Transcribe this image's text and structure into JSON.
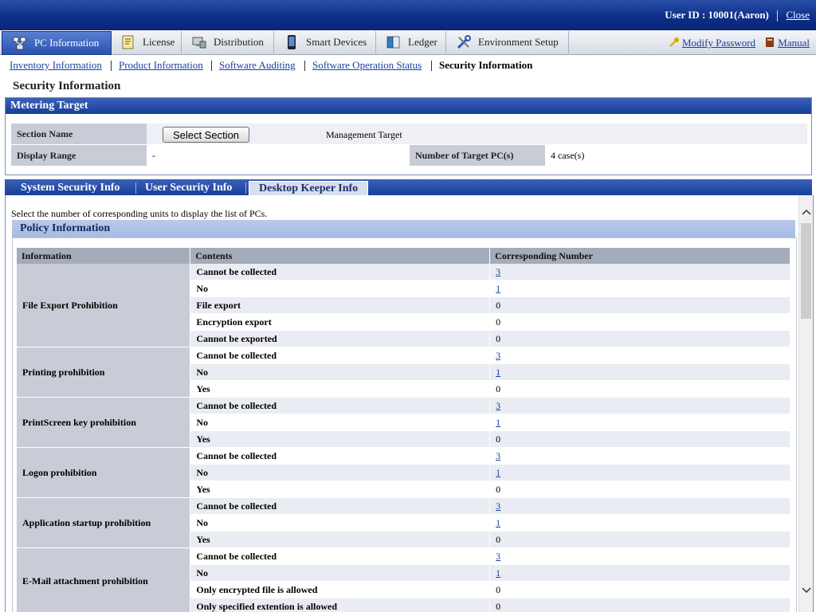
{
  "header": {
    "user_label": "User ID : 10001(Aaron)",
    "close_label": "Close"
  },
  "main_tabs": [
    {
      "label": "PC Information",
      "icon": "pc-network-icon",
      "active": true
    },
    {
      "label": "License",
      "icon": "license-document-icon",
      "active": false
    },
    {
      "label": "Distribution",
      "icon": "distribution-icon",
      "active": false
    },
    {
      "label": "Smart Devices",
      "icon": "smartphone-icon",
      "active": false
    },
    {
      "label": "Ledger",
      "icon": "ledger-book-icon",
      "active": false
    },
    {
      "label": "Environment Setup",
      "icon": "tools-icon",
      "active": false
    }
  ],
  "right_links": {
    "modify_password": "Modify Password",
    "manual": "Manual"
  },
  "subnav": {
    "items": [
      "Inventory Information",
      "Product Information",
      "Software Auditing",
      "Software Operation Status"
    ],
    "current": "Security Information"
  },
  "page_title": "Security Information",
  "metering": {
    "header": "Metering Target",
    "section_name_label": "Section Name",
    "select_section_button": "Select Section",
    "management_target": "Management Target",
    "display_range_label": "Display Range",
    "display_range_value": "-",
    "target_pcs_label": "Number of Target PC(s)",
    "target_pcs_value": "4 case(s)"
  },
  "sub_tabs": [
    {
      "label": "System Security Info",
      "active": false
    },
    {
      "label": "User Security Info",
      "active": false
    },
    {
      "label": "Desktop Keeper Info",
      "active": true
    }
  ],
  "help_text": "Select the number of corresponding units to display the list of PCs.",
  "policy": {
    "header": "Policy Information",
    "columns": [
      "Information",
      "Contents",
      "Corresponding Number"
    ],
    "groups": [
      {
        "name": "File Export Prohibition",
        "rows": [
          {
            "content": "Cannot be collected",
            "count": "3",
            "link": true
          },
          {
            "content": "No",
            "count": "1",
            "link": true
          },
          {
            "content": "File export",
            "count": "0",
            "link": false
          },
          {
            "content": "Encryption export",
            "count": "0",
            "link": false
          },
          {
            "content": "Cannot be exported",
            "count": "0",
            "link": false
          }
        ]
      },
      {
        "name": "Printing prohibition",
        "rows": [
          {
            "content": "Cannot be collected",
            "count": "3",
            "link": true
          },
          {
            "content": "No",
            "count": "1",
            "link": true
          },
          {
            "content": "Yes",
            "count": "0",
            "link": false
          }
        ]
      },
      {
        "name": "PrintScreen key prohibition",
        "rows": [
          {
            "content": "Cannot be collected",
            "count": "3",
            "link": true
          },
          {
            "content": "No",
            "count": "1",
            "link": true
          },
          {
            "content": "Yes",
            "count": "0",
            "link": false
          }
        ]
      },
      {
        "name": "Logon prohibition",
        "rows": [
          {
            "content": "Cannot be collected",
            "count": "3",
            "link": true
          },
          {
            "content": "No",
            "count": "1",
            "link": true
          },
          {
            "content": "Yes",
            "count": "0",
            "link": false
          }
        ]
      },
      {
        "name": "Application startup prohibition",
        "rows": [
          {
            "content": "Cannot be collected",
            "count": "3",
            "link": true
          },
          {
            "content": "No",
            "count": "1",
            "link": true
          },
          {
            "content": "Yes",
            "count": "0",
            "link": false
          }
        ]
      },
      {
        "name": "E-Mail attachment prohibition",
        "rows": [
          {
            "content": "Cannot be collected",
            "count": "3",
            "link": true
          },
          {
            "content": "No",
            "count": "1",
            "link": true
          },
          {
            "content": "Only encrypted file is allowed",
            "count": "0",
            "link": false
          },
          {
            "content": "Only specified extention is allowed",
            "count": "0",
            "link": false
          }
        ]
      }
    ]
  },
  "colors": {
    "header_blue": "#0c2d86",
    "section_blue": "#173f98",
    "label_gray": "#c7ccd6",
    "link_blue": "#1b3fa0"
  }
}
